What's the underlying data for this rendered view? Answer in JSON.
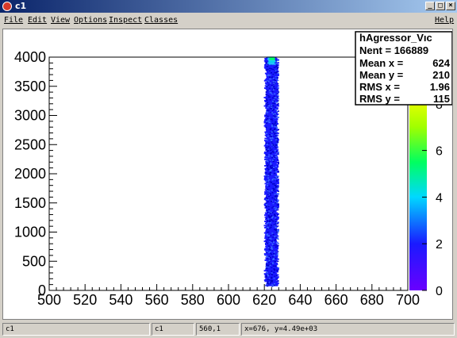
{
  "window": {
    "title": "c1",
    "buttons": [
      "_",
      "□",
      "×"
    ]
  },
  "menu": {
    "items": [
      "File",
      "Edit",
      "View",
      "Options",
      "Inspect",
      "Classes"
    ],
    "help": "Help"
  },
  "stats": {
    "title": "hAgressor_Vıc",
    "rows": [
      {
        "label": "Nent = 166889",
        "value": ""
      },
      {
        "label": "Mean x =",
        "value": "624"
      },
      {
        "label": "Mean y =",
        "value": "210"
      },
      {
        "label": "RMS x  =",
        "value": "1.96"
      },
      {
        "label": "RMS y  =",
        "value": "115"
      }
    ]
  },
  "status": {
    "cells": [
      "c1",
      "c1",
      "560,1",
      "x=676, y=4.49e+03"
    ]
  },
  "chart_data": {
    "type": "heatmap",
    "title": "",
    "xlabel": "",
    "ylabel": "",
    "xlim": [
      500,
      700
    ],
    "ylim": [
      0,
      4000
    ],
    "xticks": [
      500,
      520,
      540,
      560,
      580,
      600,
      620,
      640,
      660,
      680,
      700
    ],
    "yticks": [
      0,
      500,
      1000,
      1500,
      2000,
      2500,
      3000,
      3500,
      4000
    ],
    "z_ticks": [
      0,
      2,
      4,
      6,
      8
    ],
    "z_range": [
      0,
      10
    ],
    "band": {
      "x_center": 624,
      "x_halfwidth": 3.5,
      "y_min": 80,
      "y_max": 4000,
      "notes": "dense vertical band; blue dominant, green/cyan near y=4000"
    },
    "colors": {
      "low": "#1a1aff",
      "mid": "#00e0e0",
      "high": "#ffff00",
      "axis": "#000000"
    }
  }
}
